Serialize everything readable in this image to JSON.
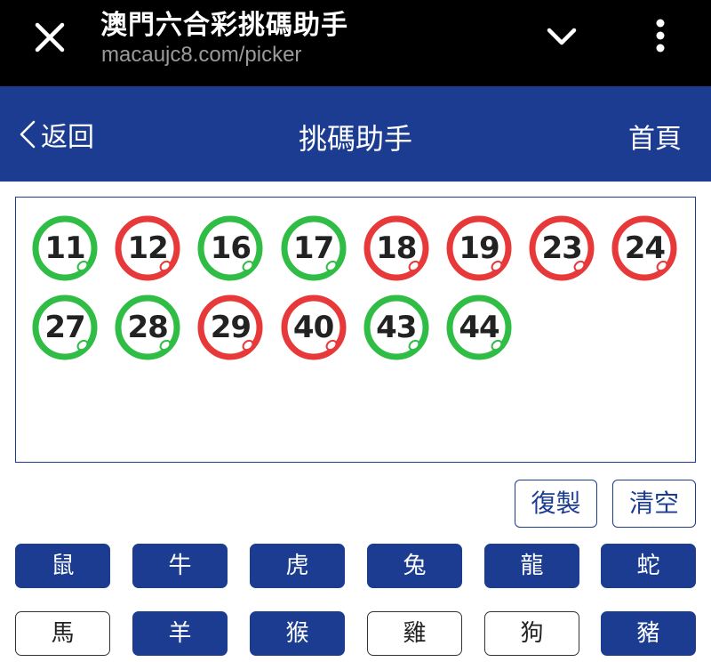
{
  "browser": {
    "title": "澳門六合彩挑碼助手",
    "url": "macaujc8.com/picker"
  },
  "header": {
    "back_label": "返回",
    "title": "挑碼助手",
    "home_label": "首頁",
    "bg_color": "#1b3c91"
  },
  "colors": {
    "red": "#e8393a",
    "green": "#2fbd45",
    "blue": "#1b3c91"
  },
  "balls": [
    {
      "number": "11",
      "color": "green"
    },
    {
      "number": "12",
      "color": "red"
    },
    {
      "number": "16",
      "color": "green"
    },
    {
      "number": "17",
      "color": "green"
    },
    {
      "number": "18",
      "color": "red"
    },
    {
      "number": "19",
      "color": "red"
    },
    {
      "number": "23",
      "color": "red"
    },
    {
      "number": "24",
      "color": "red"
    },
    {
      "number": "27",
      "color": "green"
    },
    {
      "number": "28",
      "color": "green"
    },
    {
      "number": "29",
      "color": "red"
    },
    {
      "number": "40",
      "color": "red"
    },
    {
      "number": "43",
      "color": "green"
    },
    {
      "number": "44",
      "color": "green"
    }
  ],
  "actions": {
    "copy_label": "復製",
    "clear_label": "清空"
  },
  "zodiacs": [
    {
      "label": "鼠",
      "selected": true
    },
    {
      "label": "牛",
      "selected": true
    },
    {
      "label": "虎",
      "selected": true
    },
    {
      "label": "兔",
      "selected": true
    },
    {
      "label": "龍",
      "selected": true
    },
    {
      "label": "蛇",
      "selected": true
    },
    {
      "label": "馬",
      "selected": false
    },
    {
      "label": "羊",
      "selected": true
    },
    {
      "label": "猴",
      "selected": true
    },
    {
      "label": "雞",
      "selected": false
    },
    {
      "label": "狗",
      "selected": false
    },
    {
      "label": "豬",
      "selected": true
    }
  ]
}
